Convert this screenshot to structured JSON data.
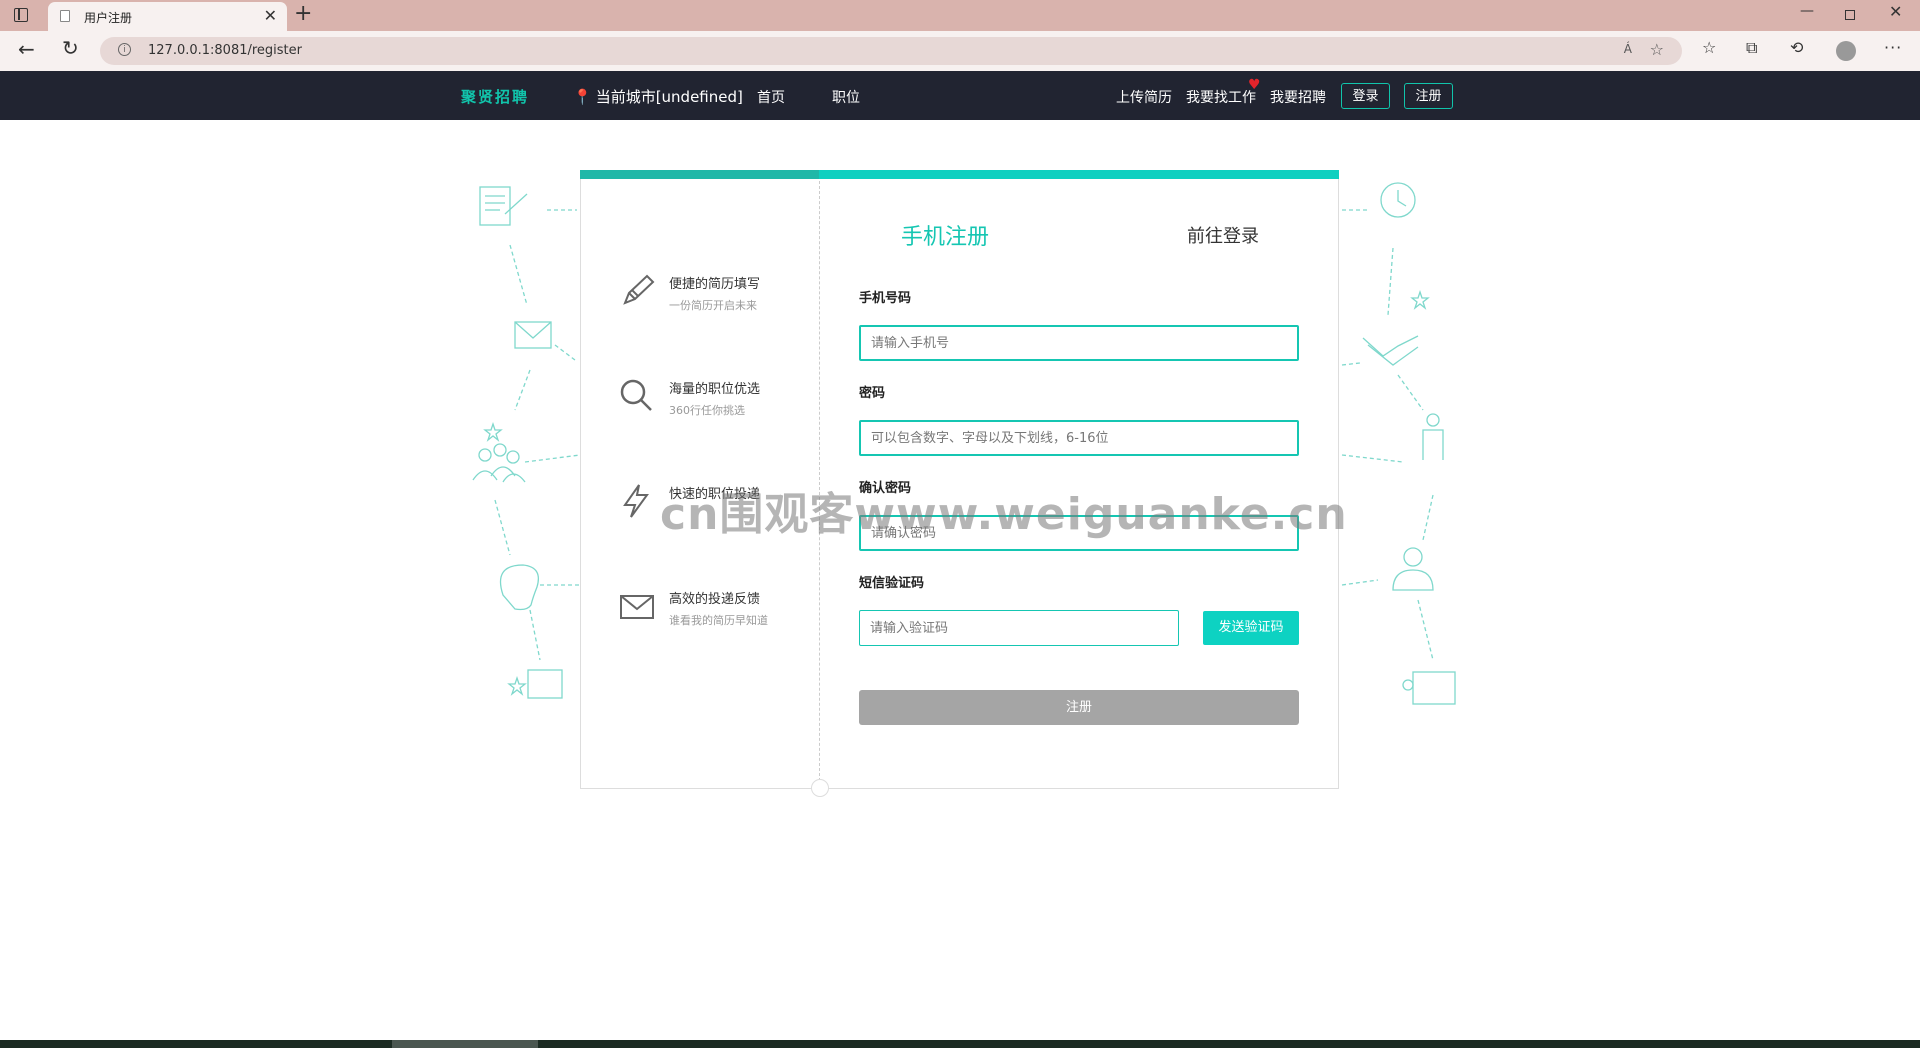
{
  "browser": {
    "tab_title": "用户注册",
    "url": "127.0.0.1:8081/register",
    "read_aloud": "Á"
  },
  "header": {
    "logo": "聚贤招聘",
    "city": "当前城市[undefined]",
    "nav_home": "首页",
    "nav_jobs": "职位",
    "upload_resume": "上传简历",
    "find_job": "我要找工作",
    "recruit": "我要招聘",
    "login": "登录",
    "register": "注册",
    "accent": "#11c4ab"
  },
  "features": [
    {
      "title": "便捷的简历填写",
      "subtitle": "一份简历开启未来",
      "icon": "pencil-icon"
    },
    {
      "title": "海量的职位优选",
      "subtitle": "360行任你挑选",
      "icon": "search-icon"
    },
    {
      "title": "快速的职位投递",
      "subtitle": "",
      "icon": "lightning-icon"
    },
    {
      "title": "高效的投递反馈",
      "subtitle": "谁看我的简历早知道",
      "icon": "mail-icon"
    }
  ],
  "form": {
    "tab_phone": "手机注册",
    "tab_login": "前往登录",
    "phone_label": "手机号码",
    "phone_placeholder": "请输入手机号",
    "password_label": "密码",
    "password_placeholder": "可以包含数字、字母以及下划线，6-16位",
    "confirm_label": "确认密码",
    "confirm_placeholder": "请确认密码",
    "code_label": "短信验证码",
    "code_placeholder": "请输入验证码",
    "send_code": "发送验证码",
    "submit": "注册"
  },
  "watermark": "cn围观客www.weiguanke.cn"
}
